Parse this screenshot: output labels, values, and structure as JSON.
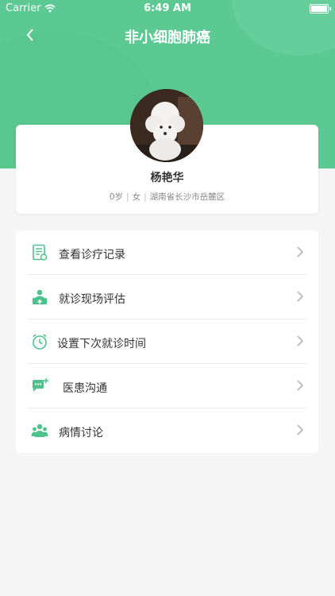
{
  "status_bar": {
    "carrier": "Carrier",
    "time": "6:49 AM"
  },
  "nav": {
    "title": "非小细胞肺癌"
  },
  "profile": {
    "name": "杨艳华",
    "age": "0岁",
    "gender": "女",
    "location": "湖南省长沙市岳麓区"
  },
  "menu": {
    "items": [
      {
        "label": "查看诊疗记录",
        "icon": "medical-record-icon"
      },
      {
        "label": "就诊现场评估",
        "icon": "doctor-desk-icon"
      },
      {
        "label": "设置下次就诊时间",
        "icon": "alarm-clock-icon"
      },
      {
        "label": "医患沟通",
        "icon": "chat-bubble-icon"
      },
      {
        "label": "病情讨论",
        "icon": "group-discussion-icon"
      }
    ]
  },
  "colors": {
    "brand_green": "#5cc992",
    "icon_green": "#4fc28b"
  }
}
